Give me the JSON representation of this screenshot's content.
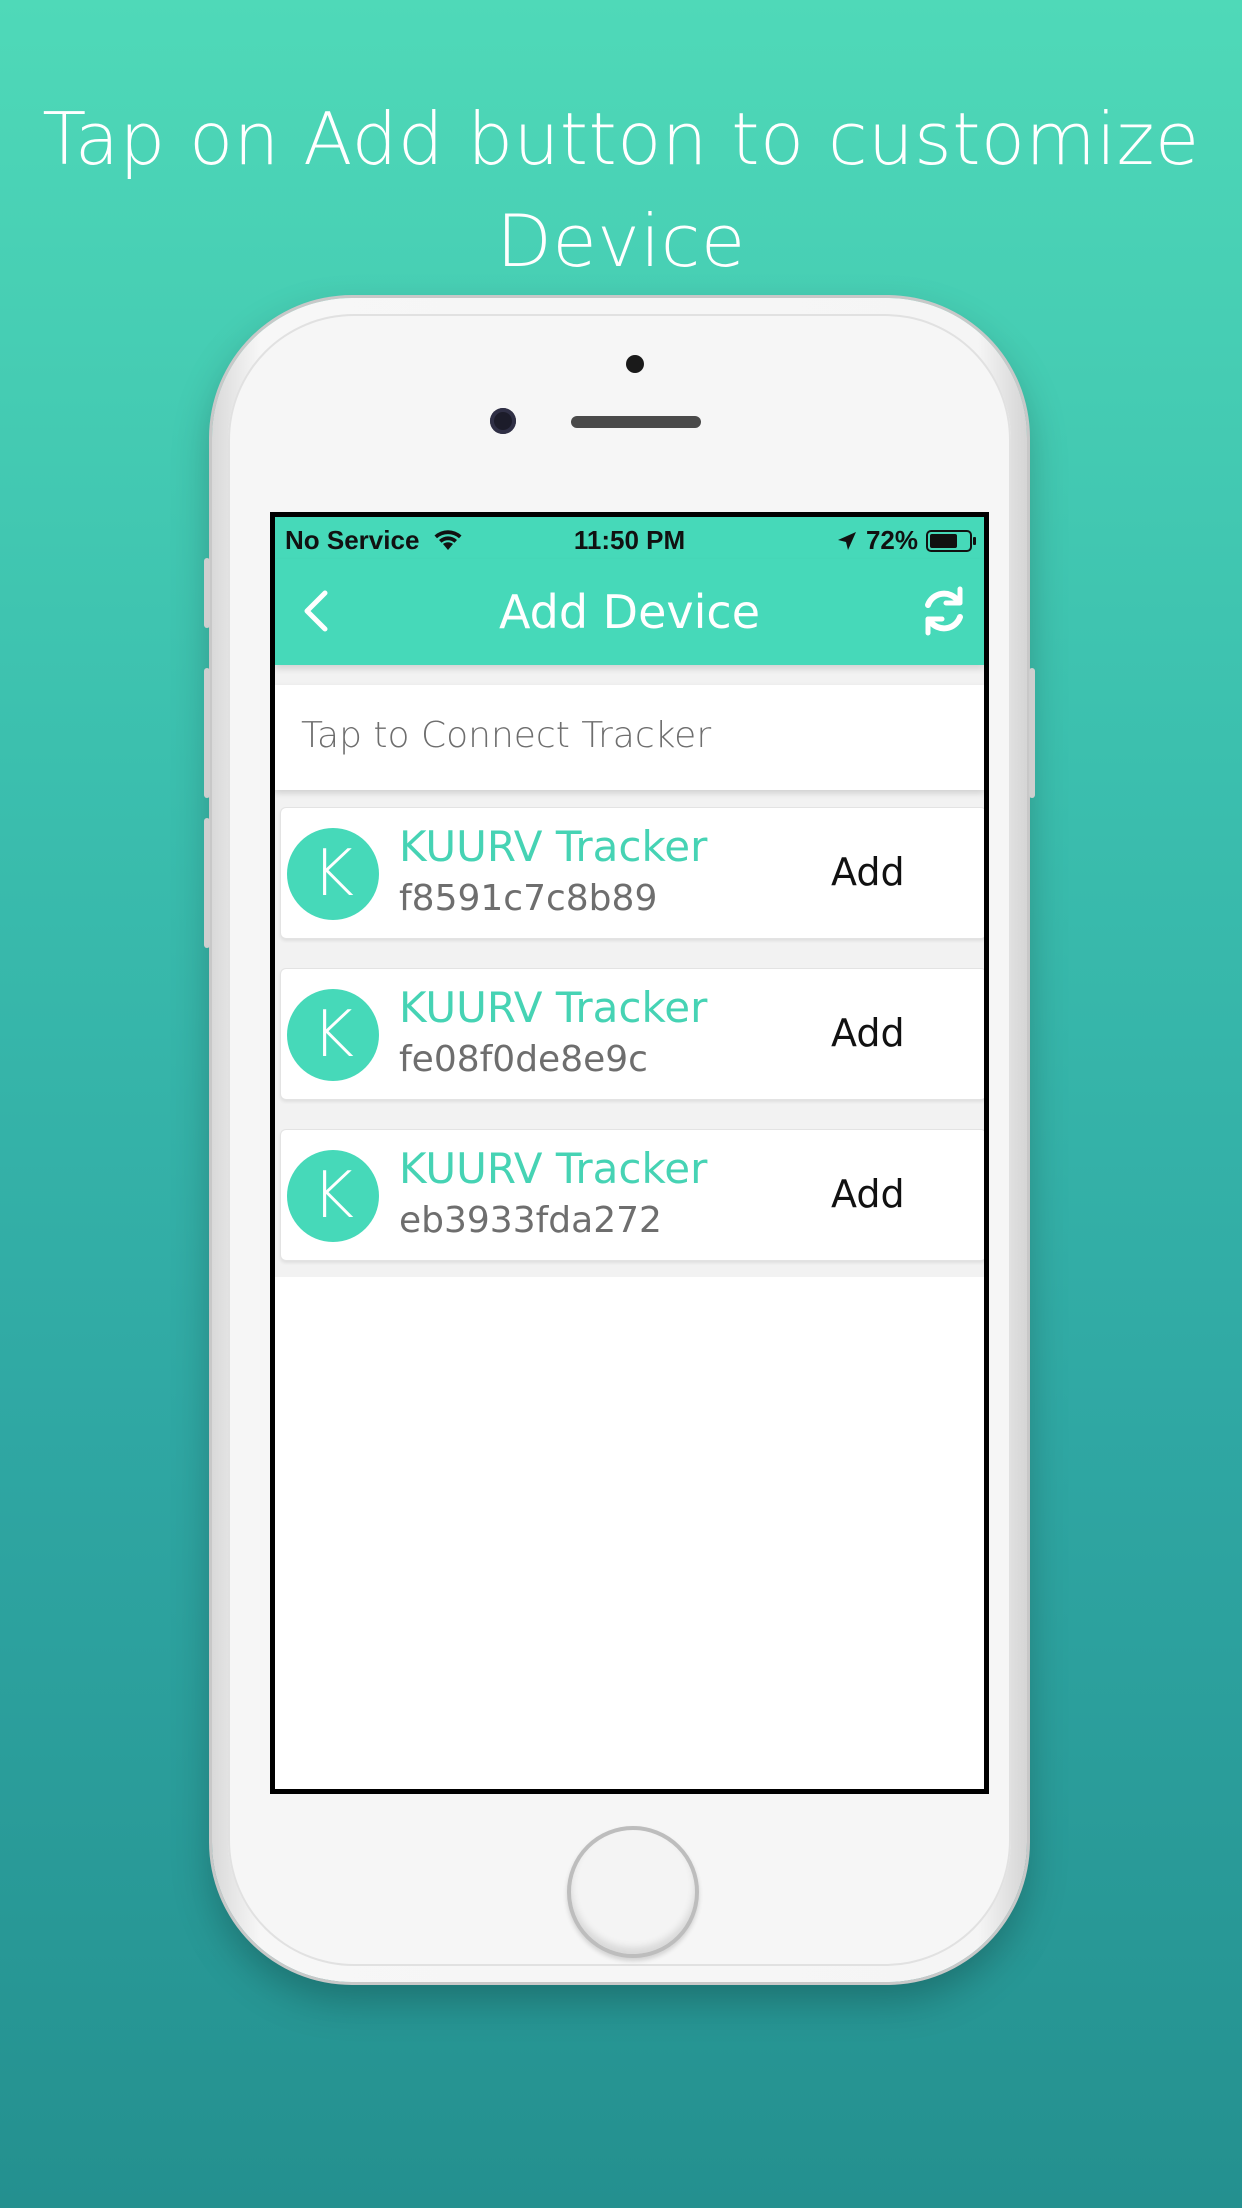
{
  "headline": {
    "line1": "Tap on Add button to customize",
    "line2": "Device"
  },
  "status_bar": {
    "carrier": "No Service",
    "time": "11:50 PM",
    "battery": "72%",
    "battery_level": 0.72
  },
  "nav": {
    "title": "Add Device",
    "back_icon": "chevron-left-icon",
    "refresh_icon": "refresh-icon"
  },
  "connect": {
    "label": "Tap to Connect Tracker"
  },
  "devices": [
    {
      "avatar": "K",
      "name": "KUURV Tracker",
      "id": "f8591c7c8b89",
      "action": "Add"
    },
    {
      "avatar": "K",
      "name": "KUURV Tracker",
      "id": "fe08f0de8e9c",
      "action": "Add"
    },
    {
      "avatar": "K",
      "name": "KUURV Tracker",
      "id": "eb3933fda272",
      "action": "Add"
    }
  ],
  "colors": {
    "accent": "#46d9b9",
    "background_top": "#4fd9b8",
    "background_bottom": "#24908f"
  }
}
